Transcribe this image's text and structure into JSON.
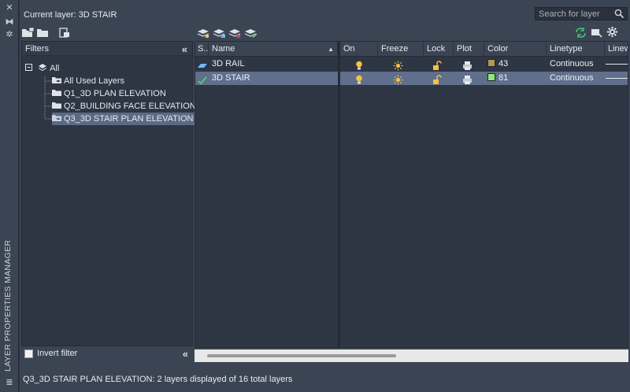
{
  "side": {
    "title": "LAYER PROPERTIES MANAGER"
  },
  "header": {
    "current_layer": "Current layer: 3D STAIR"
  },
  "search": {
    "placeholder": "Search for layer"
  },
  "filters": {
    "title": "Filters",
    "items": [
      {
        "label": "All",
        "selected": false
      },
      {
        "label": "All Used Layers",
        "selected": false
      },
      {
        "label": "Q1_3D PLAN ELEVATION",
        "selected": false
      },
      {
        "label": "Q2_BUILDING FACE ELEVATION",
        "selected": false
      },
      {
        "label": "Q3_3D STAIR PLAN ELEVATION",
        "selected": true
      }
    ],
    "invert_label": "Invert filter",
    "invert_checked": false
  },
  "grid": {
    "columns": [
      "S...",
      "Name",
      "On",
      "Freeze",
      "Lock",
      "Plot",
      "Color",
      "Linetype",
      "Linew"
    ],
    "rows": [
      {
        "name": "3D RAIL",
        "status_icon": "layer-icon",
        "on_icon": "lightbulb-on-icon",
        "freeze_icon": "sun-icon",
        "lock_icon": "unlock-icon",
        "plot_icon": "printer-icon",
        "color_value": "43",
        "color_hex": "#b59755",
        "linetype": "Continuous",
        "selected": false
      },
      {
        "name": "3D STAIR",
        "status_icon": "current-layer-check-icon",
        "on_icon": "lightbulb-on-icon",
        "freeze_icon": "sun-icon",
        "lock_icon": "unlock-icon",
        "plot_icon": "printer-icon",
        "color_value": "81",
        "color_hex": "#8fe873",
        "linetype": "Continuous",
        "selected": true
      }
    ]
  },
  "status": {
    "text": "Q3_3D STAIR PLAN ELEVATION: 2 layers displayed of 16 total layers"
  },
  "colors": {
    "panel": "#3b4453",
    "pane": "#2e3543",
    "selection": "#5f6f8c",
    "accent_refresh": "#3fbf6a"
  }
}
